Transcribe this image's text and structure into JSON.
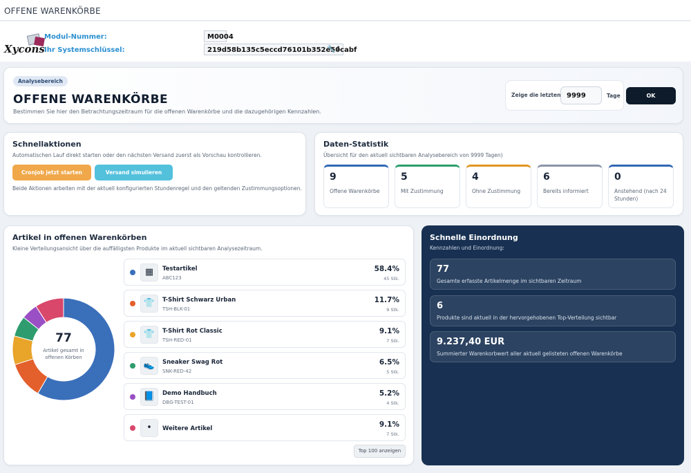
{
  "topbar": {
    "title": "OFFENE WARENKÖRBE"
  },
  "module": {
    "logo_text": "Xycons",
    "number_label": "Modul-Nummer:",
    "number_value": "M0004",
    "key_label": "Ihr Systemschlüssel:",
    "key_value": "219d58b135c5eccd76101b352e50cabf",
    "key_tools": "🔧⬇"
  },
  "hero": {
    "badge": "Analysebereich",
    "title": "OFFENE WARENKÖRBE",
    "subtitle": "Bestimmen Sie hier den Betrachtungszeitraum für die offenen Warenkörbe und die dazugehörigen Kennzahlen.",
    "range_label": "Zeige die letzten",
    "range_value": "9999",
    "range_unit": "Tage",
    "ok_label": "OK"
  },
  "quick": {
    "title": "Schnellaktionen",
    "desc": "Automatischen Lauf direkt starten oder den nächsten Versand zuerst als Vorschau kontrollieren.",
    "btn_cron": "Cronjob jetzt starten",
    "btn_sim": "Versand simulieren",
    "note": "Beide Aktionen arbeiten mit der aktuell konfigurierten Stundenregel und den geltenden Zustimmungsoptionen."
  },
  "stats": {
    "title": "Daten-Statistik",
    "desc": "Übersicht für den aktuell sichtbaren Analysebereich von 9999 Tagen)",
    "items": [
      {
        "value": "9",
        "label": "Offene Warenkörbe",
        "color": "#2f66b3"
      },
      {
        "value": "5",
        "label": "Mit Zustimmung",
        "color": "#2a9d6a"
      },
      {
        "value": "4",
        "label": "Ohne Zustimmung",
        "color": "#e2951f"
      },
      {
        "value": "6",
        "label": "Bereits informiert",
        "color": "#8a94a6"
      },
      {
        "value": "0",
        "label": "Anstehend (nach 24 Stunden)",
        "color": "#2f66b3"
      }
    ]
  },
  "articles": {
    "title": "Artikel in offenen Warenkörben",
    "desc": "Kleine Verteilungsansicht über die auffälligsten Produkte im aktuell sichtbaren Analysezeitraum.",
    "total": "77",
    "total_caption": "Artikel gesamt in offenen Körben",
    "top_button": "Top 100 anzeigen",
    "items": [
      {
        "name": "Testartikel",
        "sku": "ABC123",
        "pct": "58.4%",
        "count": "45 Stk.",
        "color": "#3a6fba",
        "icon": "▦",
        "icon_name": "placeholder-image-icon"
      },
      {
        "name": "T-Shirt Schwarz Urban",
        "sku": "TSH-BLK-01",
        "pct": "11.7%",
        "count": "9 Stk.",
        "color": "#e35f2c",
        "icon": "👕",
        "icon_name": "black-tshirt-icon"
      },
      {
        "name": "T-Shirt Rot Classic",
        "sku": "TSH-RED-01",
        "pct": "9.1%",
        "count": "7 Stk.",
        "color": "#e9a42a",
        "icon": "👕",
        "icon_name": "red-tshirt-icon"
      },
      {
        "name": "Sneaker Swag Rot",
        "sku": "SNK-RED-42",
        "pct": "6.5%",
        "count": "5 Stk.",
        "color": "#2e9c6e",
        "icon": "👟",
        "icon_name": "sneaker-icon"
      },
      {
        "name": "Demo Handbuch",
        "sku": "DBG-TEST-01",
        "pct": "5.2%",
        "count": "4 Stk.",
        "color": "#9a4fc4",
        "icon": "📘",
        "icon_name": "book-icon"
      },
      {
        "name": "Weitere Artikel",
        "sku": "",
        "pct": "9.1%",
        "count": "7 Stk.",
        "color": "#d9476b",
        "icon": "•",
        "icon_name": "more-items-icon"
      }
    ]
  },
  "chart_data": {
    "type": "pie",
    "categories": [
      "Testartikel",
      "T-Shirt Schwarz Urban",
      "T-Shirt Rot Classic",
      "Sneaker Swag Rot",
      "Demo Handbuch",
      "Weitere Artikel"
    ],
    "values": [
      58.4,
      11.7,
      9.1,
      6.5,
      5.2,
      9.1
    ],
    "colors": [
      "#3a6fba",
      "#e35f2c",
      "#e9a42a",
      "#2e9c6e",
      "#9a4fc4",
      "#d9476b"
    ],
    "center_value": "77",
    "center_label": "Artikel gesamt in offenen Körben"
  },
  "insight": {
    "title": "Schnelle Einordnung",
    "desc": "Kennzahlen und Einordnung:",
    "items": [
      {
        "value": "77",
        "caption": "Gesamte erfasste Artikelmenge im sichtbaren Zeitraum"
      },
      {
        "value": "6",
        "caption": "Produkte sind aktuell in der hervorgehobenen Top-Verteilung sichtbar"
      },
      {
        "value": "9.237,40 EUR",
        "caption": "Summierter Warenkorbwert aller aktuell gelisteten offenen Warenkörbe"
      }
    ]
  }
}
